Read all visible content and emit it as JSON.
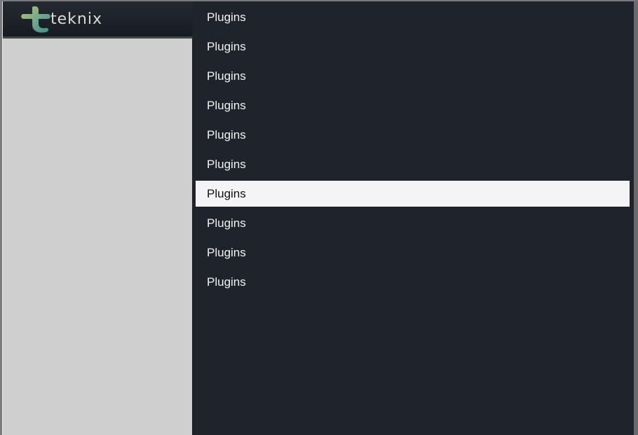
{
  "app": {
    "logo_text": "teknix",
    "colors": {
      "menu_background": "#1f232c",
      "selected_background": "#f4f3f5",
      "left_pane_background": "#cfcfcf",
      "logo_bar_background": "#1b1f26"
    }
  },
  "menu": {
    "selected_index": 6,
    "items": [
      {
        "label": "Plugins"
      },
      {
        "label": "Plugins"
      },
      {
        "label": "Plugins"
      },
      {
        "label": "Plugins"
      },
      {
        "label": "Plugins"
      },
      {
        "label": "Plugins"
      },
      {
        "label": "Plugins"
      },
      {
        "label": "Plugins"
      },
      {
        "label": "Plugins"
      },
      {
        "label": "Plugins"
      }
    ]
  }
}
